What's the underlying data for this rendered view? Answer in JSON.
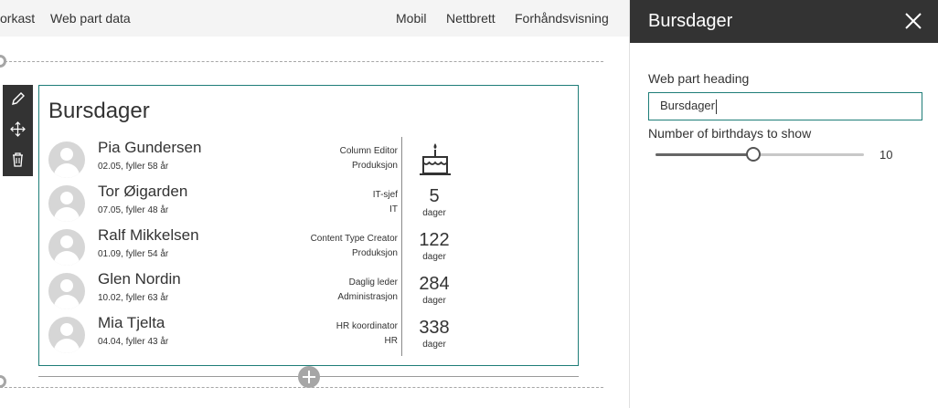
{
  "toolbar": {
    "items": [
      "orkast",
      "Web part data",
      "Mobil",
      "Nettbrett",
      "Forhåndsvisning"
    ]
  },
  "webpart": {
    "title": "Bursdager",
    "rows": [
      {
        "name": "Pia Gundersen",
        "sub": "02.05, fyller 58 år",
        "role1": "Column Editor",
        "role2": "Produksjon",
        "days": "",
        "days_label": "",
        "cake": true
      },
      {
        "name": "Tor Øigarden",
        "sub": "07.05, fyller 48 år",
        "role1": "IT-sjef",
        "role2": "IT",
        "days": "5",
        "days_label": "dager",
        "cake": false
      },
      {
        "name": "Ralf Mikkelsen",
        "sub": "01.09, fyller 54 år",
        "role1": "Content Type Creator",
        "role2": "Produksjon",
        "days": "122",
        "days_label": "dager",
        "cake": false
      },
      {
        "name": "Glen Nordin",
        "sub": "10.02, fyller 63 år",
        "role1": "Daglig leder",
        "role2": "Administrasjon",
        "days": "284",
        "days_label": "dager",
        "cake": false
      },
      {
        "name": "Mia Tjelta",
        "sub": "04.04, fyller 43 år",
        "role1": "HR koordinator",
        "role2": "HR",
        "days": "338",
        "days_label": "dager",
        "cake": false
      }
    ]
  },
  "side_icons": [
    "edit-icon",
    "move-icon",
    "delete-icon"
  ],
  "pane": {
    "title": "Bursdager",
    "heading_label": "Web part heading",
    "heading_value": "Bursdager",
    "count_label": "Number of birthdays to show",
    "count_value": "10",
    "slider_fraction": 0.47,
    "accent": "#1e7d78"
  }
}
